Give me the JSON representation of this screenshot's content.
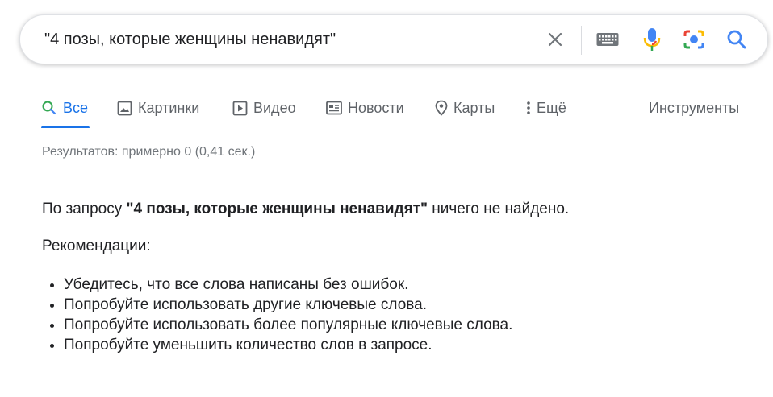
{
  "search": {
    "query": "\"4 позы, которые женщины ненавидят\""
  },
  "tabs": [
    {
      "label": "Все",
      "icon": "search-icon",
      "active": true
    },
    {
      "label": "Картинки",
      "icon": "image-icon"
    },
    {
      "label": "Видео",
      "icon": "play-icon"
    },
    {
      "label": "Новости",
      "icon": "newspaper-icon"
    },
    {
      "label": "Карты",
      "icon": "map-pin-icon"
    },
    {
      "label": "Ещё",
      "icon": "more-vertical-icon"
    }
  ],
  "tools_label": "Инструменты",
  "stats": "Результатов: примерно 0 (0,41 сек.)",
  "no_results": {
    "prefix": "По запросу ",
    "query": "\"4 позы, которые женщины ненавидят\"",
    "suffix": " ничего не найдено."
  },
  "recommendations": {
    "title": "Рекомендации:",
    "items": [
      "Убедитесь, что все слова написаны без ошибок.",
      "Попробуйте использовать другие ключевые слова.",
      "Попробуйте использовать более популярные ключевые слова.",
      "Попробуйте уменьшить количество слов в запросе."
    ]
  },
  "colors": {
    "accent": "#1a73e8",
    "text": "#202124",
    "muted": "#70757a",
    "tab_text": "#5f6368"
  }
}
